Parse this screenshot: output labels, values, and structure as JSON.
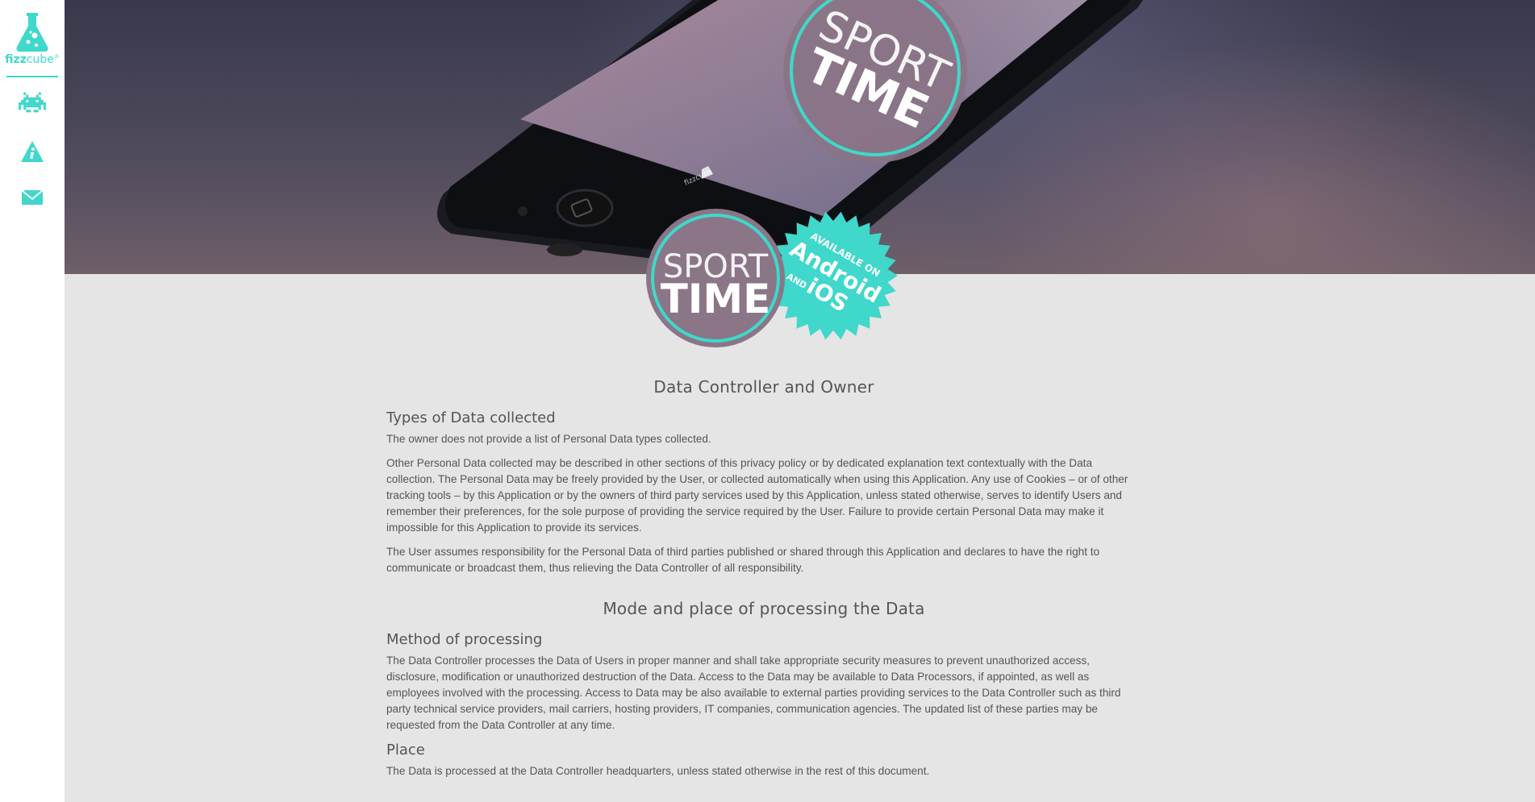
{
  "brand": {
    "name_bold": "fizz",
    "name_light": "cube",
    "reg_mark": "®",
    "accent_color": "#3fd8cb"
  },
  "sidebar": {
    "items": [
      {
        "icon": "space-invader-icon"
      },
      {
        "icon": "info-triangle-icon"
      },
      {
        "icon": "envelope-icon"
      }
    ]
  },
  "hero": {
    "app_logo_sport": "SPORT",
    "app_logo_time": "TIME",
    "phone_small_logo": "fizzcube"
  },
  "badge": {
    "logo_sport": "SPORT",
    "logo_time": "TIME",
    "available_on": "AVAILABLE ON",
    "android": "Android",
    "and": "AND",
    "ios": "iOS"
  },
  "sections": [
    {
      "title": "Data Controller and Owner",
      "subsections": [
        {
          "title": "Types of Data collected",
          "paragraphs": [
            "The owner does not provide a list of Personal Data types collected.",
            "Other Personal Data collected may be described in other sections of this privacy policy or by dedicated explanation text contextually with the Data collection. The Personal Data may be freely provided by the User, or collected automatically when using this Application. Any use of Cookies – or of other tracking tools – by this Application or by the owners of third party services used by this Application, unless stated otherwise, serves to identify Users and remember their preferences, for the sole purpose of providing the service required by the User. Failure to provide certain Personal Data may make it impossible for this Application to provide its services.",
            "The User assumes responsibility for the Personal Data of third parties published or shared through this Application and declares to have the right to communicate or broadcast them, thus relieving the Data Controller of all responsibility."
          ]
        }
      ]
    },
    {
      "title": "Mode and place of processing the Data",
      "subsections": [
        {
          "title": "Method of processing",
          "paragraphs": [
            "The Data Controller processes the Data of Users in proper manner and shall take appropriate security measures to prevent unauthorized access, disclosure, modification or unauthorized destruction of the Data. Access to the Data may be available to Data Processors, if appointed, as well as employees involved with the processing. Access to Data may be also available to external parties providing services to the Data Controller such as third party technical service providers, mail carriers, hosting providers, IT companies, communication agencies. The updated list of these parties may be requested from the Data Controller at any time."
          ]
        },
        {
          "title": "Place",
          "paragraphs": [
            "The Data is processed at the Data Controller headquarters, unless stated otherwise in the rest of this document."
          ]
        }
      ]
    }
  ]
}
